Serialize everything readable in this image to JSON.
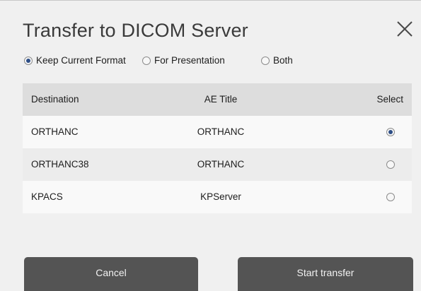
{
  "dialog": {
    "title": "Transfer to DICOM Server",
    "close_icon": "close-icon"
  },
  "format_options": [
    {
      "label": "Keep Current Format",
      "selected": true
    },
    {
      "label": "For Presentation",
      "selected": false
    },
    {
      "label": "Both",
      "selected": false
    }
  ],
  "table": {
    "headers": {
      "destination": "Destination",
      "ae_title": "AE Title",
      "select": "Select"
    },
    "rows": [
      {
        "destination": "ORTHANC",
        "ae_title": "ORTHANC",
        "selected": true
      },
      {
        "destination": "ORTHANC38",
        "ae_title": "ORTHANC",
        "selected": false
      },
      {
        "destination": "KPACS",
        "ae_title": "KPServer",
        "selected": false
      }
    ]
  },
  "buttons": {
    "cancel_label": "Cancel",
    "start_label": "Start transfer"
  },
  "colors": {
    "button_bg": "#545454",
    "radio_selected": "#2d4e86",
    "header_bg": "#dddddd"
  }
}
